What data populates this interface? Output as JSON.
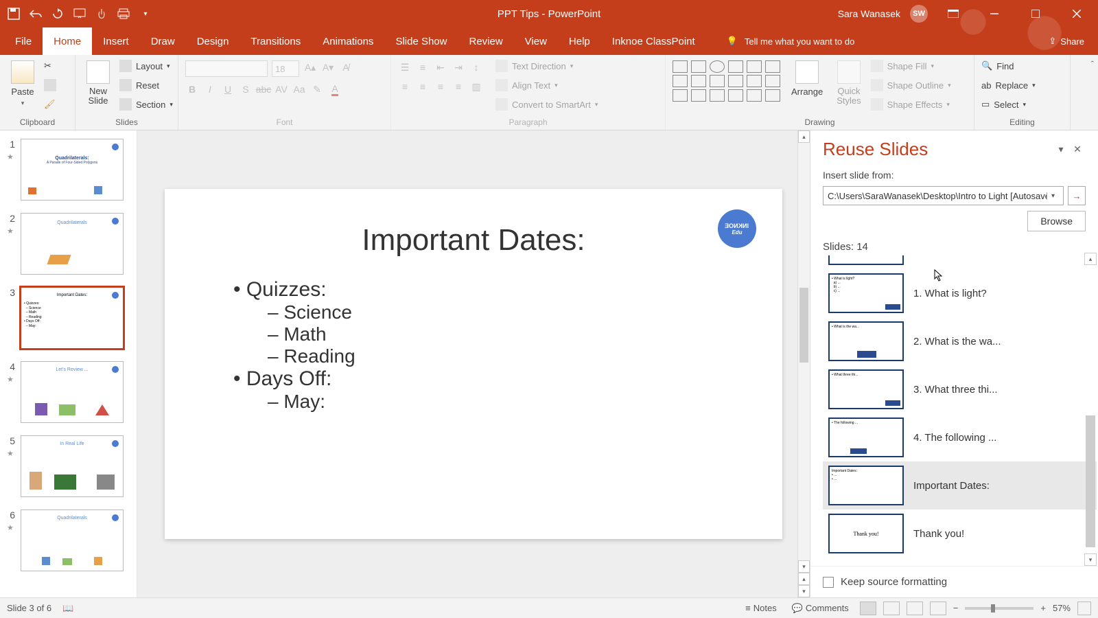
{
  "titlebar": {
    "doc_title": "PPT Tips  -  PowerPoint",
    "user_name": "Sara Wanasek",
    "user_initials": "SW"
  },
  "tabs": {
    "file": "File",
    "home": "Home",
    "insert": "Insert",
    "draw": "Draw",
    "design": "Design",
    "transitions": "Transitions",
    "animations": "Animations",
    "slideshow": "Slide Show",
    "review": "Review",
    "view": "View",
    "help": "Help",
    "classpoint": "Inknoe ClassPoint",
    "tellme": "Tell me what you want to do",
    "share": "Share"
  },
  "ribbon": {
    "clipboard": {
      "paste": "Paste",
      "label": "Clipboard"
    },
    "slides": {
      "new": "New\nSlide",
      "layout": "Layout",
      "reset": "Reset",
      "section": "Section",
      "label": "Slides"
    },
    "font": {
      "size": "18",
      "label": "Font"
    },
    "paragraph": {
      "textdir": "Text Direction",
      "align": "Align Text",
      "smartart": "Convert to SmartArt",
      "label": "Paragraph"
    },
    "drawing": {
      "arrange": "Arrange",
      "quick": "Quick\nStyles",
      "fill": "Shape Fill",
      "outline": "Shape Outline",
      "effects": "Shape Effects",
      "label": "Drawing"
    },
    "editing": {
      "find": "Find",
      "replace": "Replace",
      "select": "Select",
      "label": "Editing"
    }
  },
  "thumbnails": {
    "items": [
      {
        "num": "1"
      },
      {
        "num": "2"
      },
      {
        "num": "3"
      },
      {
        "num": "4"
      },
      {
        "num": "5"
      },
      {
        "num": "6"
      }
    ]
  },
  "slide": {
    "title": "Important Dates:",
    "b1": "Quizzes:",
    "b1a": "Science",
    "b1b": "Math",
    "b1c": "Reading",
    "b2": "Days Off:",
    "b2a": "May:",
    "badge_top": "INKNOE",
    "badge_sub": "Edu"
  },
  "reuse": {
    "title": "Reuse Slides",
    "insert_from": "Insert slide from:",
    "path": "C:\\Users\\SaraWanasek\\Desktop\\Intro to Light [Autosaved].",
    "browse": "Browse",
    "count": "Slides: 14",
    "items": [
      {
        "caption": "1. What is light?"
      },
      {
        "caption": "2. What is the wa..."
      },
      {
        "caption": "3. What three thi..."
      },
      {
        "caption": "4. The following ..."
      },
      {
        "caption": "Important Dates:"
      },
      {
        "caption": "Thank you!"
      }
    ],
    "keep": "Keep source formatting"
  },
  "statusbar": {
    "slide_of": "Slide 3 of 6",
    "notes": "Notes",
    "comments": "Comments",
    "zoom": "57%"
  }
}
